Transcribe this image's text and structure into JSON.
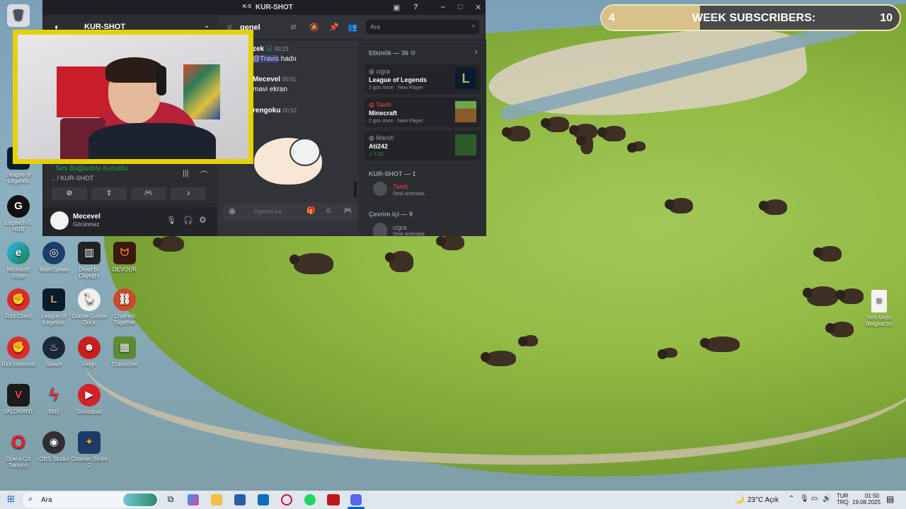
{
  "discord": {
    "window_title": "KUR-SHOT",
    "window_logo": "K-S",
    "server_name": "KUR-SHOT",
    "channel_name": "genel",
    "search_placeholder": "Ara",
    "messages": [
      {
        "author": "zek",
        "time": "00:23",
        "mention": "@Travis",
        "text": "hadıı"
      },
      {
        "author": "Mecevel",
        "time": "00:51",
        "text": "mavi ekran"
      },
      {
        "author": "rengoku",
        "time": "00:52",
        "text": ""
      }
    ],
    "message_placeholder": "#genel ka...",
    "voice_status": "Ses Bağlantısı Kuruldu",
    "voice_channel": ".. / KUR-SHOT",
    "user_name": "Mecevel",
    "user_status": "Görünmez",
    "activity_header": "Etkinlik — 36",
    "activities": [
      {
        "user": "cigra",
        "game": "League of Legends",
        "time": "2 gün önce",
        "tag": "New Player"
      },
      {
        "user": "Taieb",
        "game": "Minecraft",
        "time": "2 gün önce",
        "tag": "New Player"
      },
      {
        "user": "Marsh`",
        "game": "Ati242",
        "time": "1:22",
        "tag": ""
      }
    ],
    "group_voice": "KUR-SHOT — 1",
    "voice_member": "Taieb",
    "voice_member_status": "Sesli aramada",
    "group_online": "Çevrim içi — 9",
    "online_member": "cigra",
    "online_member_status": "Sesli aramada"
  },
  "subscribers": {
    "label": "WEEK SUBSCRIBERS:",
    "current": "4",
    "goal": "10",
    "progress": 0.33
  },
  "desktop_icons": [
    {
      "label": "Geri Dönüşüm",
      "icon": "recycle-bin-icon"
    },
    {
      "label": "League of Legends",
      "icon": "league-icon"
    },
    {
      "label": "Logitech G HUB",
      "icon": "logitech-icon"
    },
    {
      "label": "Microsoft Edge",
      "icon": "edge-icon"
    },
    {
      "label": "TeamSpeak",
      "icon": "teamspeak-icon"
    },
    {
      "label": "Dead by Daylight",
      "icon": "dbd-icon"
    },
    {
      "label": "DEVOUR",
      "icon": "devour-icon"
    },
    {
      "label": "Riot Client",
      "icon": "riot-icon"
    },
    {
      "label": "League of Legends",
      "icon": "league-icon"
    },
    {
      "label": "Goose Goose Duck",
      "icon": "goose-icon"
    },
    {
      "label": "Chained Together",
      "icon": "chained-icon"
    },
    {
      "label": "Riot İstemcisi",
      "icon": "riot-icon"
    },
    {
      "label": "Steam",
      "icon": "steam-icon"
    },
    {
      "label": "Feign",
      "icon": "feign-icon"
    },
    {
      "label": "TLauncher",
      "icon": "tlauncher-icon"
    },
    {
      "label": "VALORANT",
      "icon": "valorant-icon"
    },
    {
      "label": "Blitz",
      "icon": "blitz-icon"
    },
    {
      "label": "Soundpad",
      "icon": "soundpad-icon"
    },
    {
      "label": "Opera GX Tarayıcı",
      "icon": "opera-icon"
    },
    {
      "label": "OBS Studio",
      "icon": "obs-icon"
    },
    {
      "label": "Counter-Strike 2",
      "icon": "cs2-icon"
    },
    {
      "label": "Yeni Metin Belgesi.txt",
      "icon": "text-file-icon"
    }
  ],
  "taskbar": {
    "search_placeholder": "Ara",
    "weather": "23°C Açık",
    "language_top": "TUR",
    "language_bottom": "TRQ",
    "time": "01:50",
    "date": "19.08.2025"
  },
  "colors": {
    "discord_bg": "#313338",
    "discord_sidebar": "#2b2d31",
    "accent_green": "#23a55a",
    "webcam_frame": "#e6d100"
  }
}
